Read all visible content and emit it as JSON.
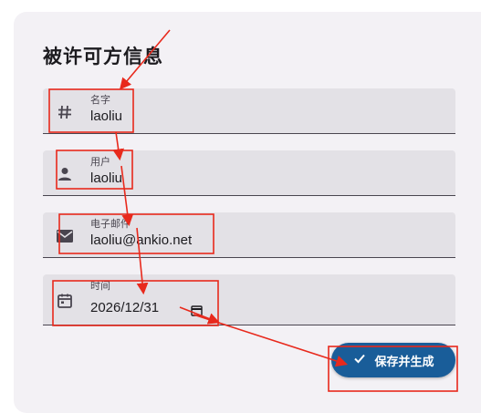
{
  "page": {
    "title": "被许可方信息"
  },
  "fields": [
    {
      "label": "名字",
      "value": "laoliu",
      "icon": "hash-icon"
    },
    {
      "label": "用户",
      "value": "laoliu",
      "icon": "person-icon"
    },
    {
      "label": "电子邮件",
      "value": "laoliu@ankio.net",
      "icon": "email-icon"
    },
    {
      "label": "时间",
      "value": "2026/12/31",
      "icon": "calendar-icon"
    }
  ],
  "actions": {
    "generate_label": "保存并生成",
    "generate_icon": "check-icon"
  },
  "annotations": {
    "color": "#e8291c"
  }
}
